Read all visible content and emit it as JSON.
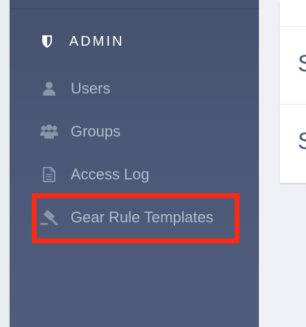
{
  "sidebar": {
    "section_title": "ADMIN",
    "items": [
      {
        "label": "Users",
        "icon": "user-icon"
      },
      {
        "label": "Groups",
        "icon": "groups-icon"
      },
      {
        "label": "Access Log",
        "icon": "document-icon"
      },
      {
        "label": "Gear Rule Templates",
        "icon": "gavel-icon"
      }
    ]
  },
  "content": {
    "rows": [
      {
        "initial": "S"
      },
      {
        "initial": "S"
      }
    ]
  },
  "colors": {
    "sidebar_bg": "#4b5876",
    "nav_text": "#b3bccd",
    "header_text": "#ffffff",
    "highlight": "#ff2a16"
  }
}
